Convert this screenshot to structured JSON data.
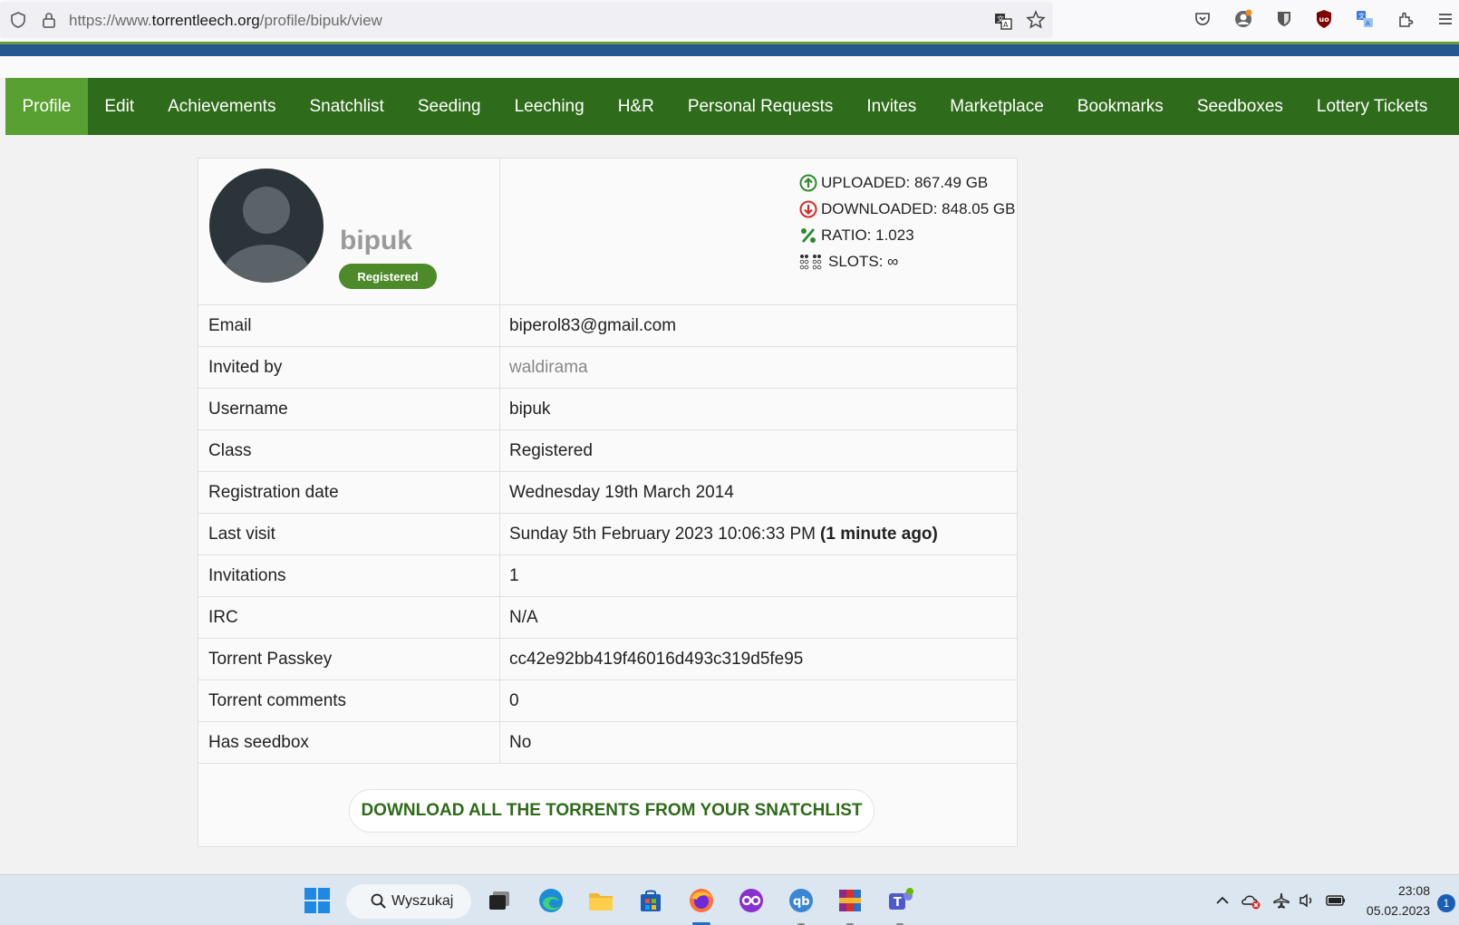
{
  "browser": {
    "url_prefix": "https://www.",
    "url_domain": "torrentleech.org",
    "url_path": "/profile/bipuk/view"
  },
  "nav": {
    "items": [
      "Profile",
      "Edit",
      "Achievements",
      "Snatchlist",
      "Seeding",
      "Leeching",
      "H&R",
      "Personal Requests",
      "Invites",
      "Marketplace",
      "Bookmarks",
      "Seedboxes",
      "Lottery Tickets"
    ],
    "active": "Profile"
  },
  "profile": {
    "username": "bipuk",
    "badge": "Registered",
    "stats": {
      "uploaded": "UPLOADED: 867.49 GB",
      "downloaded": "DOWNLOADED:  848.05 GB",
      "ratio": "RATIO: 1.023",
      "slots": "SLOTS: ∞"
    },
    "rows": [
      {
        "label": "Email",
        "value": "biperol83@gmail.com"
      },
      {
        "label": "Invited by",
        "value": "waldirama"
      },
      {
        "label": "Username",
        "value": "bipuk"
      },
      {
        "label": "Class",
        "value": "Registered"
      },
      {
        "label": "Registration date",
        "value": "Wednesday 19th March 2014"
      },
      {
        "label": "Last visit",
        "value": "Sunday 5th February 2023 10:06:33 PM",
        "extra": "(1 minute ago)"
      },
      {
        "label": "Invitations",
        "value": "1"
      },
      {
        "label": "IRC",
        "value": "N/A"
      },
      {
        "label": "Torrent Passkey",
        "value": "cc42e92bb419f46016d493c319d5fe95"
      },
      {
        "label": "Torrent comments",
        "value": "0"
      },
      {
        "label": "Has seedbox",
        "value": "No"
      }
    ],
    "download_button": "DOWNLOAD ALL THE TORRENTS FROM YOUR SNATCHLIST"
  },
  "taskbar": {
    "search_label": "Wyszukaj",
    "time": "23:08",
    "date": "05.02.2023",
    "notifications": "1"
  },
  "colors": {
    "nav_bg": "#2e6b1a",
    "nav_active": "#58a032",
    "badge": "#4d8a2a",
    "upload_icon": "#2e8b2e",
    "download_icon": "#d42a2a"
  }
}
